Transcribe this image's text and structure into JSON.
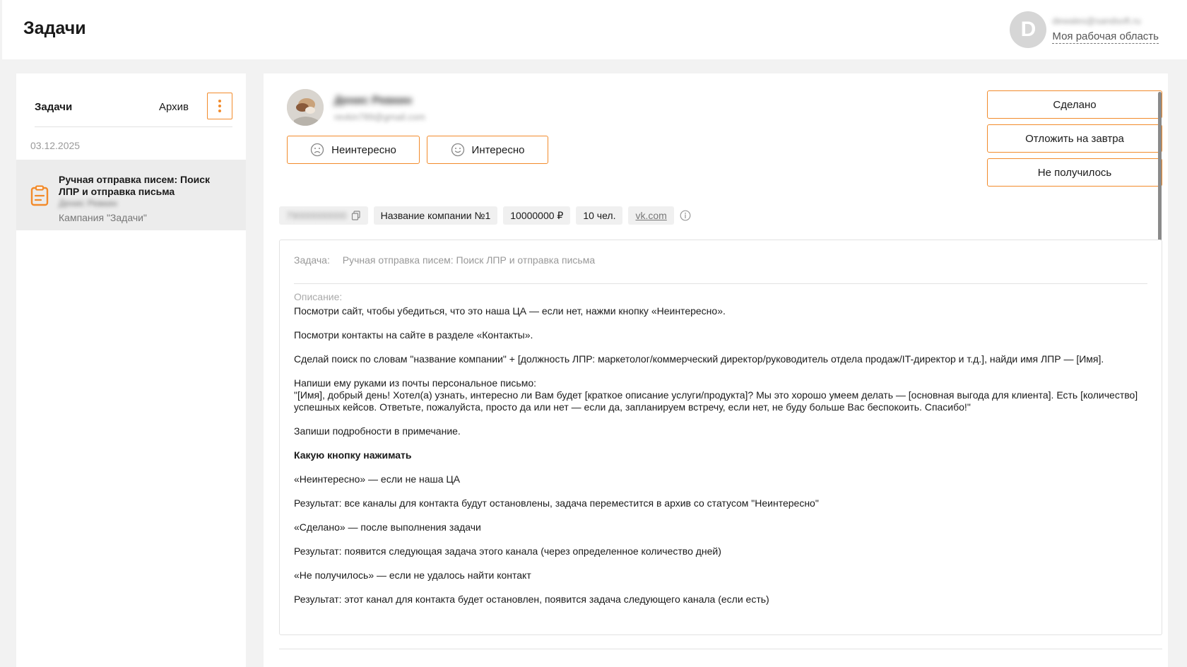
{
  "header": {
    "title": "Задачи",
    "user_initial": "D",
    "user_email": "dewales@sandsoft.ru",
    "workspace_link": "Моя рабочая область"
  },
  "sidebar": {
    "tabs": {
      "tasks": "Задачи",
      "archive": "Архив"
    },
    "date": "03.12.2025",
    "task": {
      "title": "Ручная отправка писем: Поиск ЛПР и отправка письма",
      "person": "Денис Ревкин",
      "campaign": "Кампания \"Задачи\""
    }
  },
  "contact": {
    "name": "Денис Ревкин",
    "email": "revkin789@gmail.com"
  },
  "mood_buttons": {
    "not_interested": "Неинтересно",
    "interested": "Интересно"
  },
  "actions": {
    "done": "Сделано",
    "postpone": "Отложить на завтра",
    "failed": "Не получилось"
  },
  "chips": {
    "phone": "79000000000",
    "company": "Название компании №1",
    "revenue": "10000000 ₽",
    "employees": "10 чел.",
    "site": "vk.com"
  },
  "task_box": {
    "task_label": "Задача:",
    "task_value": "Ручная отправка писем: Поиск ЛПР и отправка письма",
    "desc_label": "Описание:",
    "paragraphs": [
      "Посмотри сайт, чтобы убедиться, что это наша ЦА — если нет, нажми кнопку «Неинтересно».",
      "Посмотри контакты на сайте в разделе «Контакты».",
      "Сделай поиск по словам \"название компании\" + [должность ЛПР: маркетолог/коммерческий директор/руководитель отдела продаж/IT-директор и т.д.], найди имя ЛПР — [Имя].",
      "Напиши ему руками из почты персональное письмо:\n\"[Имя], добрый день! Хотел(а) узнать, интересно ли Вам будет [краткое описание услуги/продукта]? Мы это хорошо умеем делать — [основная выгода для клиента]. Есть [количество] успешных кейсов. Ответьте, пожалуйста, просто да или нет — если да, запланируем встречу, если нет, не буду больше Вас беспокоить. Спасибо!\"",
      "Запиши подробности в примечание.",
      "Какую кнопку нажимать",
      "«Неинтересно» — если не наша ЦА",
      "Результат: все каналы для контакта будут остановлены, задача переместится в архив со статусом \"Неинтересно\"",
      "«Сделано» — после выполнения задачи",
      "Результат: появится следующая задача этого канала (через определенное количество дней)",
      "«Не получилось» — если не удалось найти контакт",
      "Результат: этот канал для контакта будет остановлен, появится задача следующего канала (если есть)"
    ]
  },
  "colors": {
    "accent": "#f28b2b",
    "background": "#f2f2f2",
    "selected_item": "#ececec"
  }
}
